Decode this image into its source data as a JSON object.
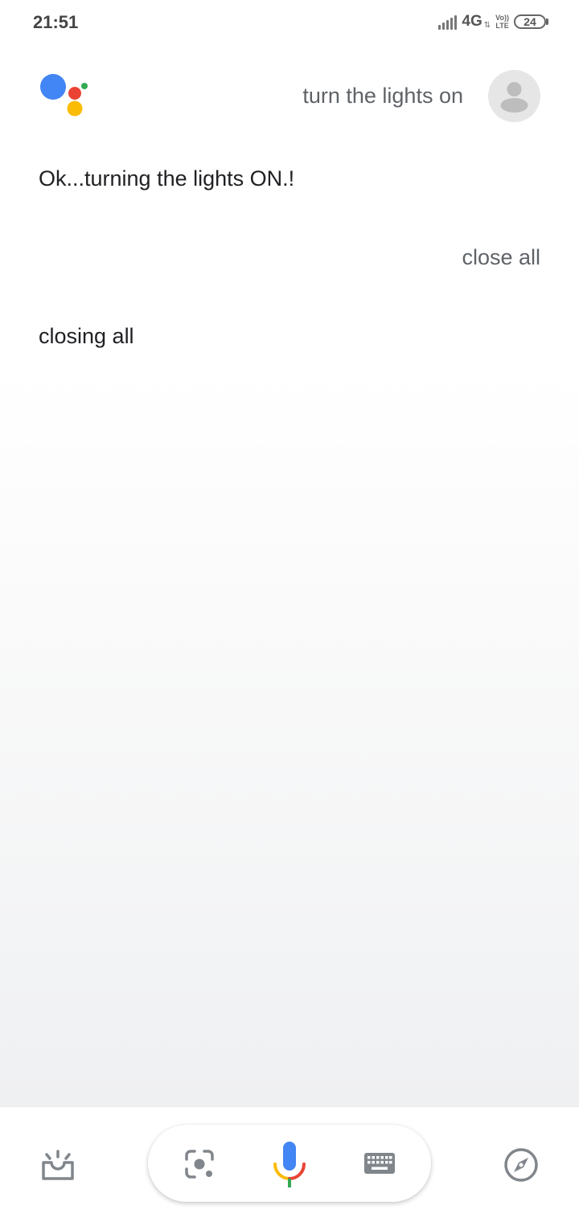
{
  "status_bar": {
    "time": "21:51",
    "network": "4G",
    "volte_top": "Vo))",
    "volte_bottom": "LTE",
    "battery": "24"
  },
  "icons": {
    "assistant_logo": "google-assistant-logo",
    "avatar": "user-avatar-icon",
    "updates": "snapshot-updates-icon",
    "lens": "google-lens-icon",
    "mic": "microphone-icon",
    "keyboard": "keyboard-icon",
    "explore": "compass-explore-icon"
  },
  "colors": {
    "blue": "#4285f4",
    "red": "#ea4335",
    "yellow": "#fbbc05",
    "green": "#34a853"
  },
  "conversation": [
    {
      "speaker": "user",
      "text": "turn the lights on"
    },
    {
      "speaker": "assistant",
      "text": "Ok...turning the lights ON.!"
    },
    {
      "speaker": "user",
      "text": "close all"
    },
    {
      "speaker": "assistant",
      "text": "closing all"
    }
  ]
}
